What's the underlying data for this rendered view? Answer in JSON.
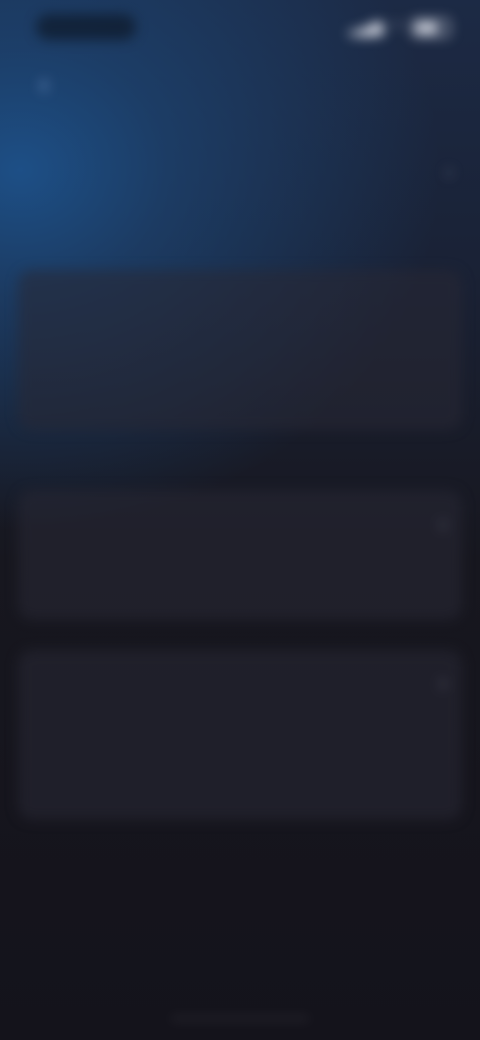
{
  "status_bar": {
    "time": "",
    "signal_icon": "signal-icon",
    "wifi_icon": "wifi-icon",
    "battery_icon": "battery-icon"
  },
  "header": {
    "back_icon": "chevron-left-icon",
    "title": ""
  },
  "account_row": {
    "label": "",
    "chevron_icon": "chevron-right-icon"
  },
  "section_one": {
    "header": "",
    "rows": [
      {
        "label": "",
        "value": ""
      },
      {
        "label": "",
        "value": ""
      }
    ]
  },
  "section_two": {
    "header": "",
    "row": {
      "label": "",
      "value": "",
      "chevron_icon": "chevron-right-icon"
    },
    "description": ""
  },
  "danger_card": {
    "label": "",
    "chevron_icon": "chevron-right-icon",
    "description": ""
  },
  "colors": {
    "accent": "#8fb2e6",
    "danger": "#e0566a",
    "background": "#14131b"
  }
}
